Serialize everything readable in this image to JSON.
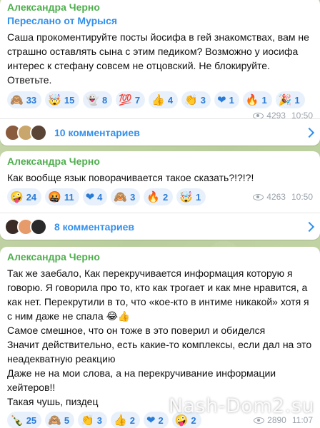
{
  "posts": [
    {
      "sender": "Александра Черно",
      "forwarded": "Переслано от Мурыся",
      "text": "Саша прокоментируйте посты йосифа в гей знакомствах, вам не страшно оставлять сына с этим педиком? Возможно у иосифа интерес к стефану совсем не отцовский. Не блокируйте. Ответьте.",
      "reactions": [
        {
          "icon": "🙈",
          "count": "33"
        },
        {
          "icon": "🤯",
          "count": "15"
        },
        {
          "icon": "👻",
          "count": "8"
        },
        {
          "icon": "💯",
          "count": "7"
        },
        {
          "icon": "👍",
          "count": "4"
        },
        {
          "icon": "👏",
          "count": "3"
        },
        {
          "icon": "❤",
          "count": "1"
        },
        {
          "icon": "🔥",
          "count": "1"
        },
        {
          "icon": "🎉",
          "count": "1"
        }
      ],
      "views": "4293",
      "time": "10:50",
      "comments": "10 комментариев"
    },
    {
      "sender": "Александра Черно",
      "text": "Как вообще язык поворачивается такое сказать?!?!?!",
      "reactions": [
        {
          "icon": "🤪",
          "count": "24"
        },
        {
          "icon": "🤬",
          "count": "11"
        },
        {
          "icon": "❤",
          "count": "4"
        },
        {
          "icon": "🙈",
          "count": "3"
        },
        {
          "icon": "🔥",
          "count": "2"
        },
        {
          "icon": "🤯",
          "count": "1"
        }
      ],
      "views": "4263",
      "time": "10:50",
      "comments": "8 комментариев"
    },
    {
      "sender": "Александра Черно",
      "text": "Так же заебало, Как перекручивается информация которую я говорю. Я говорила про то, кто как трогает и как мне нравится, а как нет. Перекрутили в то, что «кое-кто в интиме никакой» хотя я с ним даже не спала 😂👍\nСамое смешное, что он тоже в это поверил и обиделся\nЗначит действительно, есть какие-то комплексы, если дал на это неадекватную реакцию\nДаже не на мои слова, а на перекручивание информации хейтеров!!\nТакая чушь, пиздец",
      "reactions": [
        {
          "icon": "🍾",
          "count": "25"
        },
        {
          "icon": "🙈",
          "count": "5"
        },
        {
          "icon": "👏",
          "count": "3"
        },
        {
          "icon": "👍",
          "count": "2"
        },
        {
          "icon": "❤",
          "count": "2"
        },
        {
          "icon": "🤪",
          "count": "2"
        }
      ],
      "views": "2890",
      "time": "11:07"
    }
  ],
  "watermark": "Nash-Dom2.su",
  "colors": {
    "sender": "#4fae4e",
    "link": "#3390ec",
    "chip_bg": "#e8f1fb",
    "background": "#c7d6b0"
  }
}
